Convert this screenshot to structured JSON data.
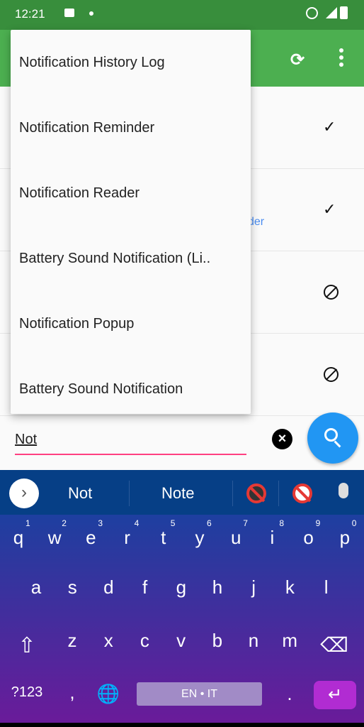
{
  "status_bar": {
    "time": "12:21",
    "icons": [
      "message-icon",
      "dot-icon",
      "alarm-icon",
      "signal-icon",
      "battery-icon"
    ]
  },
  "app_bar": {
    "actions": [
      "refresh-icon",
      "more-vert-icon"
    ],
    "color": "#4caf50"
  },
  "list": {
    "rows": [
      {
        "status": "check"
      },
      {
        "status": "check",
        "subtitle_fragment": "der"
      },
      {
        "status": "blocked"
      },
      {
        "status": "blocked"
      }
    ]
  },
  "dropdown": {
    "items": [
      "Notification History Log",
      "Notification Reminder",
      "Notification Reader",
      "Battery Sound Notification (Li..",
      "Notification Popup",
      "Battery Sound Notification"
    ]
  },
  "search": {
    "value": "Not",
    "clear_icon": "clear-icon",
    "button_icon": "search-icon",
    "accent": "#ff4081",
    "fab_color": "#2196f3"
  },
  "keyboard": {
    "suggestions": [
      "Not",
      "Note"
    ],
    "rows": [
      [
        "q",
        "w",
        "e",
        "r",
        "t",
        "y",
        "u",
        "i",
        "o",
        "p"
      ],
      [
        "a",
        "s",
        "d",
        "f",
        "g",
        "h",
        "j",
        "k",
        "l"
      ],
      [
        "z",
        "x",
        "c",
        "v",
        "b",
        "n",
        "m"
      ]
    ],
    "numbers": [
      "1",
      "2",
      "3",
      "4",
      "5",
      "6",
      "7",
      "8",
      "9",
      "0"
    ],
    "symbols_key": "?123",
    "comma": ",",
    "period": ".",
    "space_label": "EN • IT",
    "shift": "⇧",
    "backspace": "⌫",
    "enter": "↵",
    "expand": "›",
    "globe": "🌐"
  }
}
